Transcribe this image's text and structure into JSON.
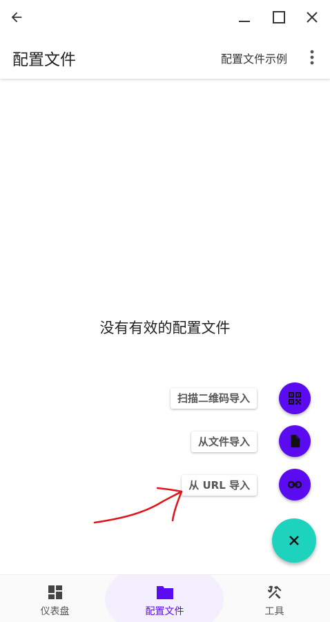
{
  "appbar": {
    "title": "配置文件",
    "action_label": "配置文件示例"
  },
  "content": {
    "empty_message": "没有有效的配置文件"
  },
  "fab_menu": {
    "items": [
      {
        "label": "扫描二维码导入",
        "icon": "qr-code-icon"
      },
      {
        "label": "从文件导入",
        "icon": "file-icon"
      },
      {
        "label": "从 URL 导入",
        "icon": "link-icon"
      }
    ],
    "main_icon": "close-icon"
  },
  "bottom_nav": {
    "items": [
      {
        "label": "仪表盘",
        "icon": "dashboard-icon",
        "active": false
      },
      {
        "label": "配置文件",
        "icon": "folder-icon",
        "active": true
      },
      {
        "label": "工具",
        "icon": "tools-icon",
        "active": false
      }
    ]
  },
  "colors": {
    "accent": "#5b0bf0",
    "fab": "#1ed3bd",
    "annotation": "#e0161b"
  }
}
